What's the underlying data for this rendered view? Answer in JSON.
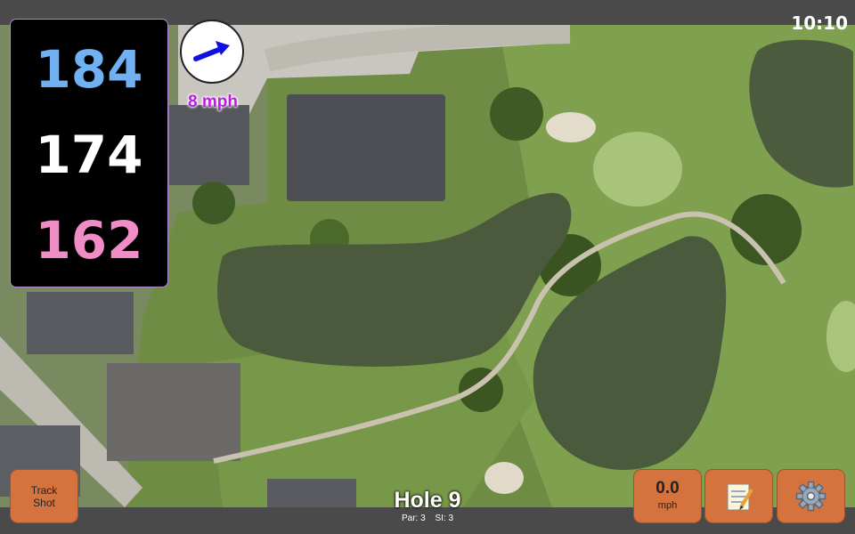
{
  "status": {
    "time": "10:10"
  },
  "distances": {
    "back": "184",
    "middle": "174",
    "front": "162"
  },
  "wind": {
    "speed_label": "8 mph",
    "direction_icon": "wind-arrow-icon"
  },
  "hole": {
    "title": "Hole 9",
    "par": "Par: 3",
    "si": "SI: 3"
  },
  "buttons": {
    "track_shot_line1": "Track",
    "track_shot_line2": "Shot",
    "speed_value": "0.0",
    "speed_unit": "mph",
    "notes_icon": "notepad-icon",
    "settings_icon": "gear-icon"
  },
  "colors": {
    "back": "#6fb1f2",
    "middle": "#ffffff",
    "front": "#f08cc6",
    "button": "#d5733f",
    "wind_text": "#b91ee0",
    "panel": "#000000"
  }
}
